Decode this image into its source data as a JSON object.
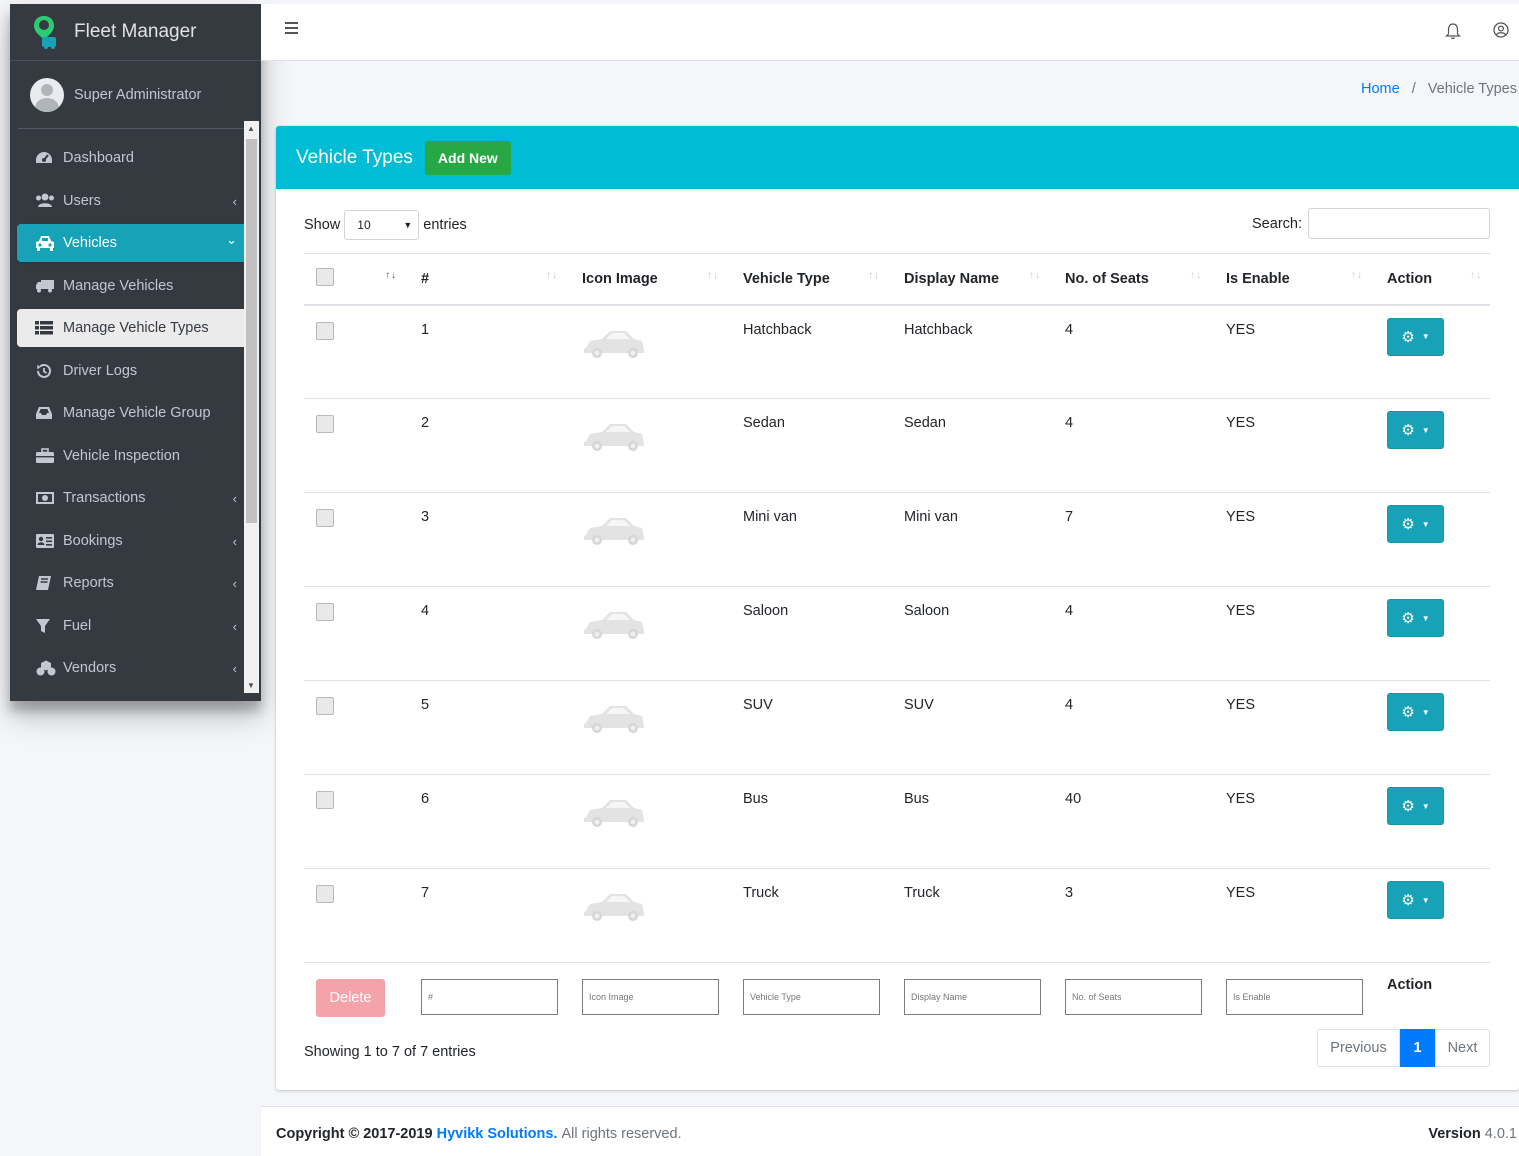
{
  "brand": {
    "name": "Fleet Manager",
    "accent": "#17a2b8"
  },
  "user": {
    "name": "Super Administrator"
  },
  "sidebar": {
    "items": [
      {
        "label": "Dashboard",
        "icon": "tachometer-icon",
        "caret": ""
      },
      {
        "label": "Users",
        "icon": "users-icon",
        "caret": "‹"
      },
      {
        "label": "Vehicles",
        "icon": "taxi-icon",
        "caret": "⌄"
      },
      {
        "label": "Manage Vehicles",
        "icon": "truck-icon",
        "caret": ""
      },
      {
        "label": "Manage Vehicle Types",
        "icon": "list-icon",
        "caret": ""
      },
      {
        "label": "Driver Logs",
        "icon": "history-icon",
        "caret": ""
      },
      {
        "label": "Manage Vehicle Group",
        "icon": "inbox-icon",
        "caret": ""
      },
      {
        "label": "Vehicle Inspection",
        "icon": "briefcase-icon",
        "caret": ""
      },
      {
        "label": "Transactions",
        "icon": "money-icon",
        "caret": "‹"
      },
      {
        "label": "Bookings",
        "icon": "address-card-icon",
        "caret": "‹"
      },
      {
        "label": "Reports",
        "icon": "book-icon",
        "caret": "‹"
      },
      {
        "label": "Fuel",
        "icon": "filter-icon",
        "caret": "‹"
      },
      {
        "label": "Vendors",
        "icon": "cubes-icon",
        "caret": "‹"
      }
    ]
  },
  "breadcrumb": {
    "home": "Home",
    "separator": "/",
    "current": "Vehicle Types"
  },
  "card": {
    "title": "Vehicle Types",
    "add_label": "Add New",
    "header_color": "#00bcd4"
  },
  "table_controls": {
    "show": "Show",
    "entries_value": "10",
    "entries": "entries",
    "search_label": "Search:"
  },
  "table": {
    "columns": [
      "#",
      "Icon Image",
      "Vehicle Type",
      "Display Name",
      "No. of Seats",
      "Is Enable",
      "Action"
    ],
    "rows": [
      {
        "num": "1",
        "type": "Hatchback",
        "display": "Hatchback",
        "seats": "4",
        "enable": "YES"
      },
      {
        "num": "2",
        "type": "Sedan",
        "display": "Sedan",
        "seats": "4",
        "enable": "YES"
      },
      {
        "num": "3",
        "type": "Mini van",
        "display": "Mini van",
        "seats": "7",
        "enable": "YES"
      },
      {
        "num": "4",
        "type": "Saloon",
        "display": "Saloon",
        "seats": "4",
        "enable": "YES"
      },
      {
        "num": "5",
        "type": "SUV",
        "display": "SUV",
        "seats": "4",
        "enable": "YES"
      },
      {
        "num": "6",
        "type": "Bus",
        "display": "Bus",
        "seats": "40",
        "enable": "YES"
      },
      {
        "num": "7",
        "type": "Truck",
        "display": "Truck",
        "seats": "3",
        "enable": "YES"
      }
    ],
    "footer": {
      "delete_label": "Delete",
      "filters": [
        "#",
        "Icon Image",
        "Vehicle Type",
        "Display Name",
        "No. of Seats",
        "Is Enable"
      ],
      "action_label": "Action"
    }
  },
  "pagination": {
    "info": "Showing 1 to 7 of 7 entries",
    "previous": "Previous",
    "page": "1",
    "next": "Next"
  },
  "footer": {
    "copyright_prefix": "Copyright © 2017-2019",
    "company": "Hyvikk Solutions.",
    "rights": "All rights reserved.",
    "version_label": "Version",
    "version_number": "4.0.1"
  }
}
